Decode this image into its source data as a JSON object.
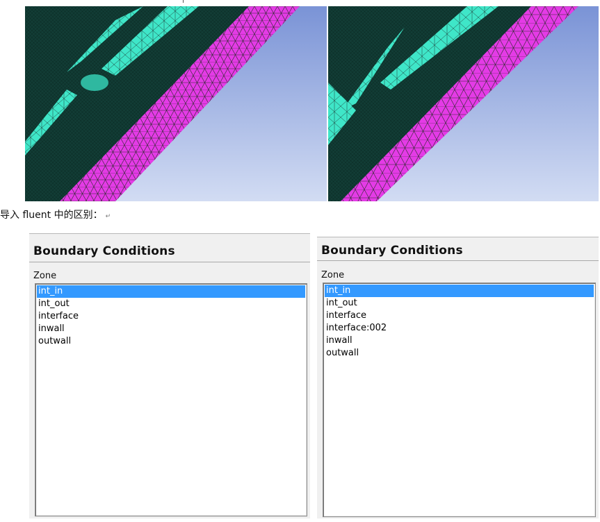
{
  "colors": {
    "sky_top": "#7a93d6",
    "sky_bottom": "#d2dcf3",
    "solid_dark": "#123c35",
    "fluid_cyan": "#3fe6c8",
    "wall_magenta": "#e43be6",
    "mesh_line": "#1a1a1a",
    "selection": "#3399ff"
  },
  "caption": {
    "text": "导入 fluent 中的区别：",
    "return_mark": "↵"
  },
  "left_panel": {
    "title": "Boundary Conditions",
    "zone_label": "Zone",
    "zones": [
      "int_in",
      "int_out",
      "interface",
      "inwall",
      "outwall"
    ],
    "selected": "int_in"
  },
  "right_panel": {
    "title": "Boundary Conditions",
    "zone_label": "Zone",
    "zones": [
      "int_in",
      "int_out",
      "interface",
      "interface:002",
      "inwall",
      "outwall"
    ],
    "selected": "int_in"
  }
}
